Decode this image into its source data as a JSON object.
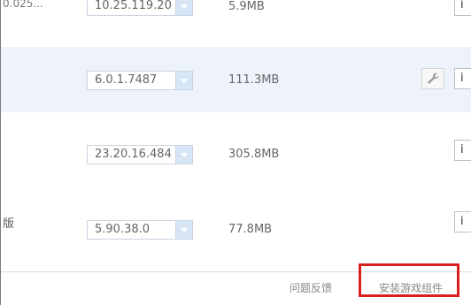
{
  "rows": [
    {
      "name": "0.025...",
      "version": "10.25.119.20",
      "size": "5.9MB",
      "action": "i",
      "has_wrench": false
    },
    {
      "name": "",
      "version": "6.0.1.7487",
      "size": "111.3MB",
      "action": "i",
      "has_wrench": true
    },
    {
      "name": "",
      "version": "23.20.16.484",
      "size": "305.8MB",
      "action": "i",
      "has_wrench": false
    },
    {
      "name": "版",
      "version": "5.90.38.0",
      "size": "77.8MB",
      "action": "i",
      "has_wrench": false
    }
  ],
  "footer": {
    "feedback_label": "问题反馈",
    "install_label": "安装游戏组件"
  },
  "colors": {
    "highlight_row": "#eef3fb",
    "dropdown_arrow": "#d7e6f6",
    "callout_red": "#d9201f"
  },
  "icons": {
    "dropdown": "chevron-down-icon",
    "tools": "wrench-icon"
  }
}
